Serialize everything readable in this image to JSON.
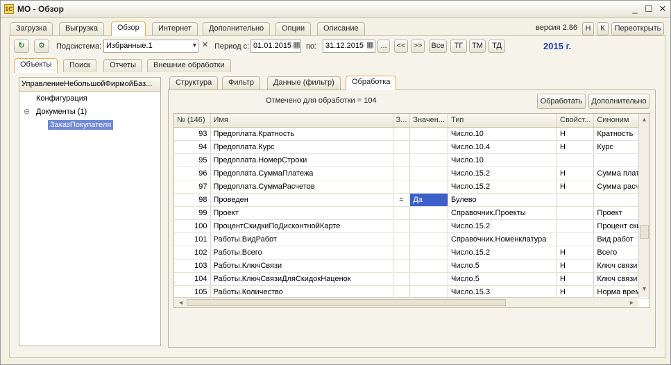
{
  "window": {
    "title": "МО - Обзор",
    "icon": "1C",
    "minimize": "_",
    "maximize": "☐",
    "close": "✕"
  },
  "main_tabs": [
    "Загрузка",
    "Выгрузка",
    "Обзор",
    "Интернет",
    "Дополнительно",
    "Опции",
    "Описание"
  ],
  "version": {
    "text": "версия 2.86",
    "h_label": "Н",
    "k_label": "К",
    "reopen_label": "Переоткрыть"
  },
  "toolbar": {
    "subsystem_label": "Подсистема:",
    "subsystem_value": "Избранные.1",
    "period_label": "Период с:",
    "date_from": "01.01.2015",
    "to_label": "по:",
    "date_to": "31.12.2015",
    "ellipsis": "...",
    "prev": "<<",
    "next": ">>",
    "all": "Все",
    "tg": "ТГ",
    "tm": "ТМ",
    "td": "ТД",
    "year_label": "2015 г."
  },
  "sub_tabs": [
    "Объекты",
    "Поиск",
    "Отчеты",
    "Внешние обработки"
  ],
  "tree": {
    "header": "УправлениеНебольшойФирмойБаз...",
    "config": "Конфигурация",
    "documents": "Документы (1)",
    "doc_item": "ЗаказПокупателя",
    "collapse_glyph": "⊖"
  },
  "right_tabs": [
    "Структура",
    "Фильтр",
    "Данные (фильтр)",
    "Обработка"
  ],
  "marked_text": "Отмечено для обработки = 104",
  "process_label": "Обработать",
  "additional_label": "Дополнительно",
  "table": {
    "columns": [
      "№ (146)",
      "Имя",
      "З...",
      "Значен...",
      "Тип",
      "Свойст...",
      "Синоним"
    ],
    "rows": [
      [
        "93",
        "Предоплата.Кратность",
        "",
        "",
        "Число.10",
        "Н",
        "Кратность"
      ],
      [
        "94",
        "Предоплата.Курс",
        "",
        "",
        "Число.10.4",
        "Н",
        "Курс"
      ],
      [
        "95",
        "Предоплата.НомерСтроки",
        "",
        "",
        "Число.10",
        "",
        ""
      ],
      [
        "96",
        "Предоплата.СуммаПлатежа",
        "",
        "",
        "Число.15.2",
        "Н",
        "Сумма плате"
      ],
      [
        "97",
        "Предоплата.СуммаРасчетов",
        "",
        "",
        "Число.15.2",
        "Н",
        "Сумма расче"
      ],
      [
        "98",
        "Проведен",
        "=",
        "Да",
        "Булево",
        "",
        ""
      ],
      [
        "99",
        "Проект",
        "",
        "",
        "Справочник.Проекты",
        "",
        "Проект"
      ],
      [
        "100",
        "ПроцентСкидкиПоДисконтнойКарте",
        "",
        "",
        "Число.15.2",
        "",
        "Процент скид"
      ],
      [
        "101",
        "Работы.ВидРабот",
        "",
        "",
        "Справочник.Номенклатура",
        "",
        "Вид работ"
      ],
      [
        "102",
        "Работы.Всего",
        "",
        "",
        "Число.15.2",
        "Н",
        "Всего"
      ],
      [
        "103",
        "Работы.КлючСвязи",
        "",
        "",
        "Число.5",
        "Н",
        "Ключ связи"
      ],
      [
        "104",
        "Работы.КлючСвязиДляСкидокНаценок",
        "",
        "",
        "Число.5",
        "Н",
        "Ключ связи"
      ],
      [
        "105",
        "Работы.Количество",
        "",
        "",
        "Число.15.3",
        "Н",
        "Норма врем"
      ]
    ]
  },
  "icons": {
    "refresh": "↻",
    "settings": "⚙",
    "dropdown": "▼",
    "clear": "✕",
    "calendar": "▦",
    "scroll_up": "▲",
    "scroll_down": "▼",
    "scroll_left": "◄",
    "scroll_right": "►"
  },
  "colors": {
    "year": "#1f3cb0",
    "active_tab_border": "#e6a84a",
    "selection": "#3c60c8"
  }
}
